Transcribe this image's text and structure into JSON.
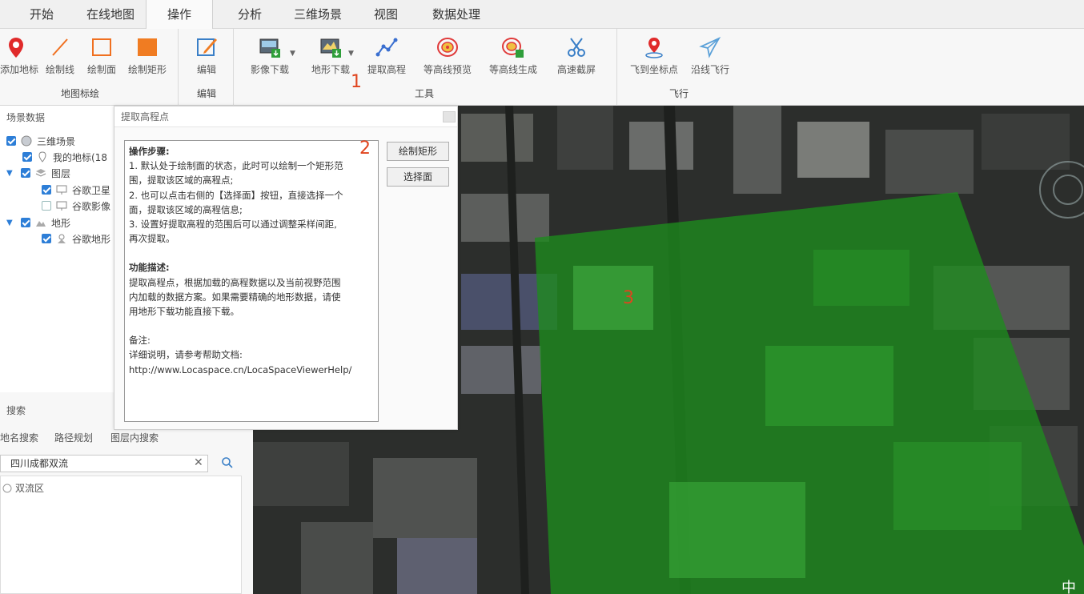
{
  "tabs": [
    "开始",
    "在线地图",
    "操作",
    "分析",
    "三维场景",
    "视图",
    "数据处理"
  ],
  "active_tab": "操作",
  "ribbon": {
    "groups": [
      {
        "label": "地图标绘",
        "buttons": [
          {
            "label": "添加地标",
            "icon": "map-pin-icon"
          },
          {
            "label": "绘制线",
            "icon": "line-icon"
          },
          {
            "label": "绘制面",
            "icon": "polygon-icon"
          },
          {
            "label": "绘制矩形",
            "icon": "rectangle-icon"
          }
        ]
      },
      {
        "label": "编辑",
        "buttons": [
          {
            "label": "编辑",
            "icon": "edit-icon"
          }
        ]
      },
      {
        "label": "工具",
        "buttons": [
          {
            "label": "影像下载",
            "icon": "image-download-icon"
          },
          {
            "label": "地形下载",
            "icon": "terrain-download-icon"
          },
          {
            "label": "提取高程",
            "icon": "elevation-icon"
          },
          {
            "label": "等高线预览",
            "icon": "contour-preview-icon"
          },
          {
            "label": "等高线生成",
            "icon": "contour-generate-icon"
          },
          {
            "label": "高速截屏",
            "icon": "scissors-icon"
          }
        ]
      },
      {
        "label": "飞行",
        "buttons": [
          {
            "label": "飞到坐标点",
            "icon": "fly-to-point-icon"
          },
          {
            "label": "沿线飞行",
            "icon": "plane-icon"
          }
        ]
      }
    ],
    "marker_1": "1"
  },
  "scene_panel": {
    "title": "场景数据",
    "tree": [
      {
        "label": "三维场景",
        "checked": true,
        "icon": "globe-icon"
      },
      {
        "label": "我的地标(18",
        "checked": true,
        "icon": "pin-icon"
      },
      {
        "label": "图层",
        "checked": true,
        "icon": "layers-icon"
      },
      {
        "label": "谷歌卫星",
        "checked": true,
        "icon": "monitor-icon"
      },
      {
        "label": "谷歌影像",
        "checked": false,
        "icon": "monitor-icon"
      },
      {
        "label": "地形",
        "checked": true,
        "icon": "terrain-icon"
      },
      {
        "label": "谷歌地形",
        "checked": true,
        "icon": "terrain-layer-icon"
      }
    ]
  },
  "search_panel": {
    "title": "搜索",
    "tabs": [
      "地名搜索",
      "路径规划",
      "图层内搜索"
    ],
    "query": "四川成都双流",
    "results": [
      "双流区"
    ]
  },
  "dialog": {
    "title": "提取高程点",
    "marker_2": "2",
    "lines": [
      "操作步骤:",
      "1. 默认处于绘制面的状态，此时可以绘制一个矩形范",
      "围，提取该区域的高程点;",
      "2. 也可以点击右侧的【选择面】按钮，直接选择一个",
      "面，提取该区域的高程信息;",
      "3. 设置好提取高程的范围后可以通过调整采样间距,",
      "再次提取。",
      "",
      "功能描述:",
      "提取高程点，根据加载的高程数据以及当前视野范围",
      "内加载的数据方案。如果需要精确的地形数据，请使",
      "用地形下载功能直接下载。",
      "",
      "备注:",
      "详细说明，请参考帮助文档:",
      "http://www.Locaspace.cn/LocaSpaceViewerHelp/"
    ],
    "buttons": [
      "绘制矩形",
      "选择面"
    ]
  },
  "map": {
    "marker_3": "3",
    "corner_text": "中",
    "overlay_color": "#1e8c1e"
  }
}
